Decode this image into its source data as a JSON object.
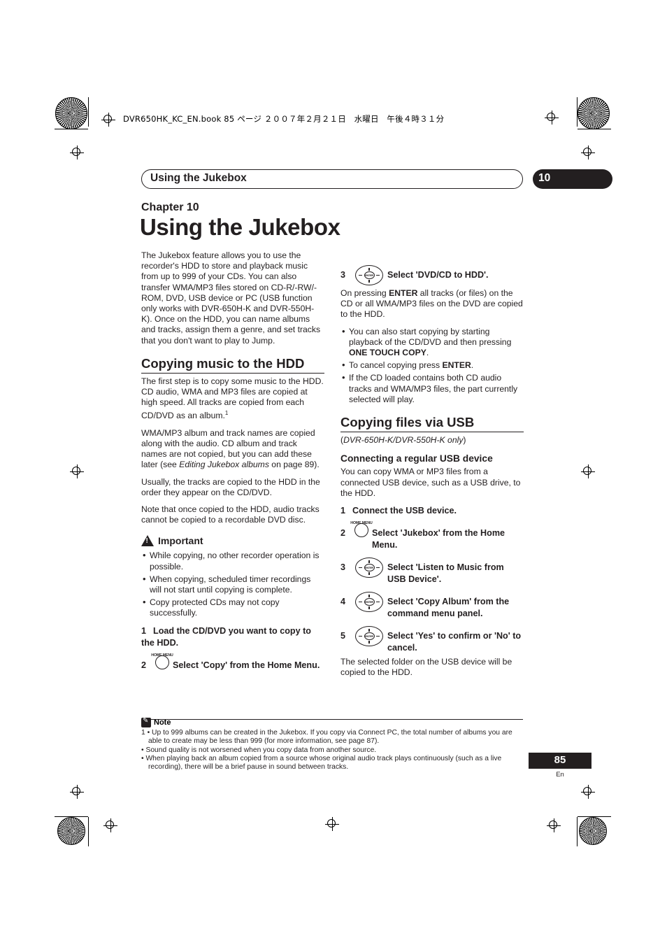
{
  "header": {
    "bookline": "DVR650HK_KC_EN.book  85 ページ  ２００７年２月２１日　水曜日　午後４時３１分"
  },
  "running_head": {
    "title": "Using the Jukebox",
    "chapter_number": "10"
  },
  "chapter": {
    "label": "Chapter 10",
    "title": "Using the Jukebox"
  },
  "left_column": {
    "intro": "The Jukebox feature allows you to use the recorder's HDD to store and playback music from up to 999 of your CDs. You can also transfer WMA/MP3 files stored on CD-R/-RW/-ROM, DVD, USB device or PC (USB function only works with DVR-650H-K and DVR-550H-K). Once on the HDD, you can name albums and tracks, assign them a genre, and set tracks that you don't want to play to Jump.",
    "section_title": "Copying music to the HDD",
    "para1_a": "The first step is to copy some music to the HDD. CD audio, WMA and MP3 files are copied at high speed. All tracks are copied from each CD/DVD as an album.",
    "para1_sup": "1",
    "para2_a": "WMA/MP3 album and track names are copied along with the audio. CD album and track names are not copied, but you can add these later (see ",
    "para2_italic": "Editing Jukebox albums",
    "para2_b": " on page 89).",
    "para3": "Usually, the tracks are copied to the HDD in the order they appear on the CD/DVD.",
    "para4": "Note that once copied to the HDD, audio tracks cannot be copied to a recordable DVD disc.",
    "important_label": "Important",
    "important_bullets": [
      "While copying, no other recorder operation is possible.",
      "When copying, scheduled timer recordings will not start until copying is complete.",
      "Copy protected CDs may not copy successfully."
    ],
    "step1_num": "1",
    "step1_text": "Load the CD/DVD you want to copy to the HDD.",
    "step2_num": "2",
    "step2_icon": "HOME MENU",
    "step2_text": "Select 'Copy' from the Home Menu."
  },
  "right_column": {
    "step3_num": "3",
    "step3_icon": "ENTER",
    "step3_text": "Select 'DVD/CD to HDD'.",
    "para_a_1": "On pressing ",
    "para_a_bold": "ENTER",
    "para_a_2": " all tracks (or files) on the CD or all WMA/MP3 files on the DVD are copied to the HDD.",
    "bullets": [
      {
        "a": "You can also start copying by starting playback of the CD/DVD and then pressing ",
        "bold": "ONE TOUCH COPY",
        "b": "."
      },
      {
        "a": "To cancel copying press ",
        "bold": "ENTER",
        "b": "."
      },
      {
        "a": "If the CD loaded contains both CD audio tracks and WMA/MP3 files, the part currently selected will play.",
        "bold": "",
        "b": ""
      }
    ],
    "section_title": "Copying files via USB",
    "models_line_italic": "DVR-650H-K/DVR-550H-K only",
    "subsection_title": "Connecting a regular USB device",
    "para_b": "You can copy WMA or MP3 files from a connected USB device, such as a USB drive, to the HDD.",
    "step1_num": "1",
    "step1_text": "Connect the USB device.",
    "step2_num": "2",
    "step2_icon": "HOME MENU",
    "step2_text": "Select 'Jukebox' from the Home Menu.",
    "step3b_num": "3",
    "step3b_icon": "ENTER",
    "step3b_text": "Select 'Listen to Music from USB Device'.",
    "step4_num": "4",
    "step4_icon": "ENTER",
    "step4_text": "Select 'Copy Album' from the command menu panel.",
    "step5_num": "5",
    "step5_icon": "ENTER",
    "step5_text": "Select 'Yes' to confirm or 'No' to cancel.",
    "para_c": "The selected folder on the USB device will be copied to the HDD."
  },
  "note": {
    "label": "Note",
    "line1": "1 • Up to 999 albums can be created in the Jukebox. If  you copy via Connect PC, the total number of albums you are able to create may be less than 999 (for more information, see page 87).",
    "line2": "• Sound quality is not worsened when you copy data from another source.",
    "line3": "• When playing back an album copied from a source whose original audio track plays continuously (such as a live recording), there will be a brief pause in sound between tracks."
  },
  "footer": {
    "page_number": "85",
    "language": "En"
  }
}
